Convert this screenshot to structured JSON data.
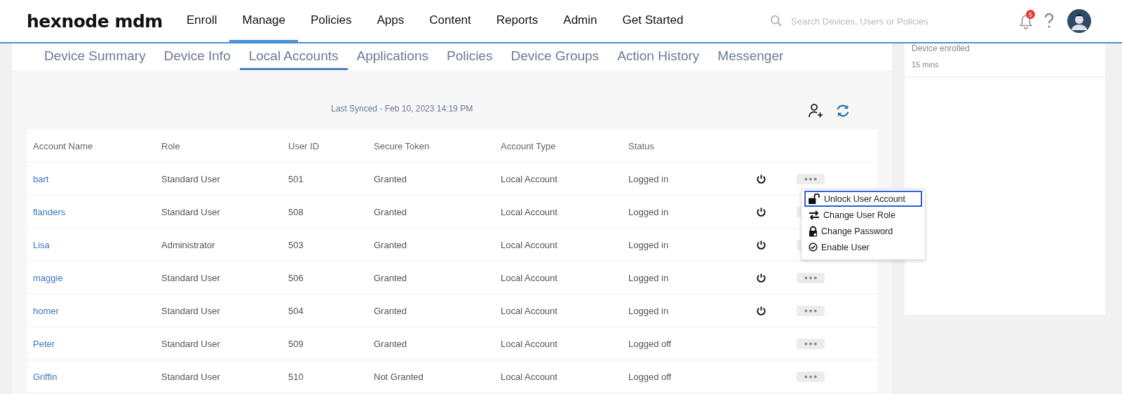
{
  "header": {
    "logo": "hexnode mdm",
    "nav": [
      {
        "label": "Enroll",
        "selected": false
      },
      {
        "label": "Manage",
        "selected": true
      },
      {
        "label": "Policies",
        "selected": false
      },
      {
        "label": "Apps",
        "selected": false
      },
      {
        "label": "Content",
        "selected": false
      },
      {
        "label": "Reports",
        "selected": false
      },
      {
        "label": "Admin",
        "selected": false
      },
      {
        "label": "Get Started",
        "selected": false
      }
    ],
    "search": {
      "placeholder": "Search Devices, Users or Policies"
    },
    "notification_count": "5"
  },
  "tabs": [
    {
      "label": "Device Summary",
      "selected": false
    },
    {
      "label": "Device Info",
      "selected": false
    },
    {
      "label": "Local Accounts",
      "selected": true
    },
    {
      "label": "Applications",
      "selected": false
    },
    {
      "label": "Policies",
      "selected": false
    },
    {
      "label": "Device Groups",
      "selected": false
    },
    {
      "label": "Action History",
      "selected": false
    },
    {
      "label": "Messenger",
      "selected": false
    }
  ],
  "last_synced": "Last Synced - Feb 10, 2023 14:19 PM",
  "table": {
    "columns": [
      "Account Name",
      "Role",
      "User ID",
      "Secure Token",
      "Account Type",
      "Status"
    ],
    "rows": [
      {
        "cells": [
          "bart",
          "Standard User",
          "501",
          "Granted",
          "Local Account",
          "Logged in"
        ],
        "power_button": true
      },
      {
        "cells": [
          "flanders",
          "Standard User",
          "508",
          "Granted",
          "Local Account",
          "Logged in"
        ],
        "power_button": true
      },
      {
        "cells": [
          "Lisa",
          "Administrator",
          "503",
          "Granted",
          "Local Account",
          "Logged in"
        ],
        "power_button": true
      },
      {
        "cells": [
          "maggie",
          "Standard User",
          "506",
          "Granted",
          "Local Account",
          "Logged in"
        ],
        "power_button": true
      },
      {
        "cells": [
          "homer",
          "Standard User",
          "504",
          "Granted",
          "Local Account",
          "Logged in"
        ],
        "power_button": true
      },
      {
        "cells": [
          "Peter",
          "Standard User",
          "509",
          "Granted",
          "Local Account",
          "Logged off"
        ],
        "power_button": false
      },
      {
        "cells": [
          "Griffin",
          "Standard User",
          "510",
          "Not Granted",
          "Local Account",
          "Logged off"
        ],
        "power_button": false
      }
    ]
  },
  "menu": {
    "items": [
      {
        "kind": "unlock",
        "label": "Unlock User Account",
        "selected": true
      },
      {
        "kind": "role",
        "label": "Change User Role",
        "selected": false
      },
      {
        "kind": "password",
        "label": "Change Password",
        "selected": false
      },
      {
        "kind": "enable",
        "label": "Enable User",
        "selected": false
      }
    ]
  },
  "activity": {
    "title": "Device enrolled",
    "time": "15 mins"
  }
}
